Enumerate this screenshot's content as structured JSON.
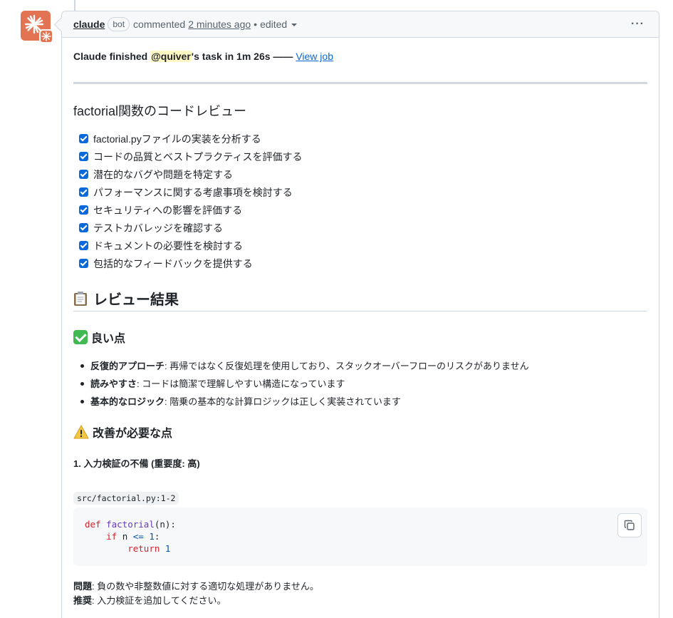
{
  "header": {
    "author": "claude",
    "bot_badge": "bot",
    "commented": "commented",
    "time": "2 minutes ago",
    "separator": "•",
    "edited": "edited",
    "more": "···"
  },
  "status": {
    "prefix": "Claude finished ",
    "mention": "@quiver",
    "suffix": "'s task in 1m 26s —— ",
    "link": "View job"
  },
  "review_heading": "factorial関数のコードレビュー",
  "tasks": [
    "factorial.pyファイルの実装を分析する",
    "コードの品質とベストプラクティスを評価する",
    "潜在的なバグや問題を特定する",
    "パフォーマンスに関する考慮事項を検討する",
    "セキュリティへの影響を評価する",
    "テストカバレッジを確認する",
    "ドキュメントの必要性を検討する",
    "包括的なフィードバックを提供する"
  ],
  "result_heading": "レビュー結果",
  "good_heading": "良い点",
  "good_points": [
    {
      "term": "反復的アプローチ",
      "desc": ": 再帰ではなく反復処理を使用しており、スタックオーバーフローのリスクがありません"
    },
    {
      "term": "読みやすさ",
      "desc": ": コードは簡潔で理解しやすい構造になっています"
    },
    {
      "term": "基本的なロジック",
      "desc": ": 階乗の基本的な計算ロジックは正しく実装されています"
    }
  ],
  "improve_heading": "改善が必要な点",
  "issue1_heading": "1. 入力検証の不備 (重要度: 高)",
  "file_ref": "src/factorial.py:1-2",
  "code": {
    "l1_kw": "def",
    "l1_fn": "factorial",
    "l1_rest": "(n):",
    "l2_kw": "if",
    "l2_var": " n ",
    "l2_op": "<=",
    "l2_num": " 1",
    "l2_colon": ":",
    "l3_kw": "return",
    "l3_num": " 1"
  },
  "problem": {
    "label1": "問題",
    "text1": ": 負の数や非整数値に対する適切な処理がありません。",
    "label2": "推奨",
    "text2": ": 入力検証を追加してください。"
  },
  "colors": {
    "accent": "#0969da",
    "avatar": "#e27453",
    "mention_bg": "#fff8c5",
    "check_green": "#3fb950"
  }
}
